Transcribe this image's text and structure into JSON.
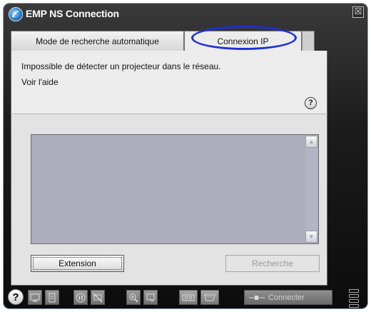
{
  "window": {
    "title": "EMP NS Connection",
    "close_glyph": "☒"
  },
  "tabs": [
    {
      "label": "Mode de recherche automatique",
      "selected": false
    },
    {
      "label": "Connexion IP",
      "selected": true
    }
  ],
  "message": {
    "line1": "Impossible de détecter un projecteur dans le réseau.",
    "line2": "Voir l'aide",
    "help_glyph": "?"
  },
  "list": {
    "scroll_up_glyph": "▲",
    "scroll_down_glyph": "▼"
  },
  "buttons": {
    "extension": "Extension",
    "search": "Recherche"
  },
  "toolbar": {
    "help_glyph": "?",
    "connect_label": "Connecter"
  },
  "colors": {
    "annotation_ring": "#1d2fd6",
    "frame": "#1c1c1c"
  }
}
